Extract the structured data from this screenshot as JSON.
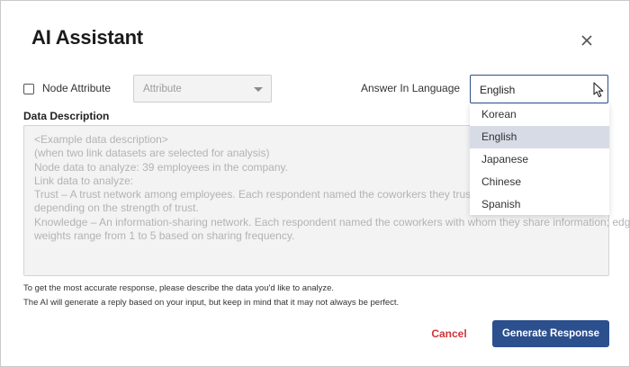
{
  "dialog": {
    "title": "AI Assistant",
    "close_icon": "close-icon"
  },
  "options": {
    "node_attribute_label": "Node Attribute",
    "node_attribute_checked": false,
    "attribute_placeholder": "Attribute",
    "answer_language_label": "Answer In Language",
    "answer_language_value": "English",
    "language_options": [
      "Korean",
      "English",
      "Japanese",
      "Chinese",
      "Spanish"
    ],
    "selected_language_index": 1
  },
  "description": {
    "label": "Data Description",
    "placeholder_lines": [
      "<Example data description>",
      "(when two link datasets are selected for analysis)",
      "Node data to analyze: 39 employees in the company.",
      "Link data to analyze:",
      "Trust – A trust network among employees. Each respondent named the coworkers they trust; edge we",
      "depending on the strength of trust.",
      "Knowledge – An information-sharing network. Each respondent named the coworkers with whom they share information; edge",
      "weights range from 1 to 5 based on sharing frequency."
    ]
  },
  "help": {
    "line1": "To get the most accurate response, please describe the data you'd like to analyze.",
    "line2": "The AI will generate a reply based on your input, but keep in mind that it may not always be perfect."
  },
  "actions": {
    "cancel_label": "Cancel",
    "generate_label": "Generate Response"
  },
  "colors": {
    "accent": "#2c4f8d",
    "cancel": "#d0343a",
    "selected_option_bg": "#d7dbe6"
  }
}
